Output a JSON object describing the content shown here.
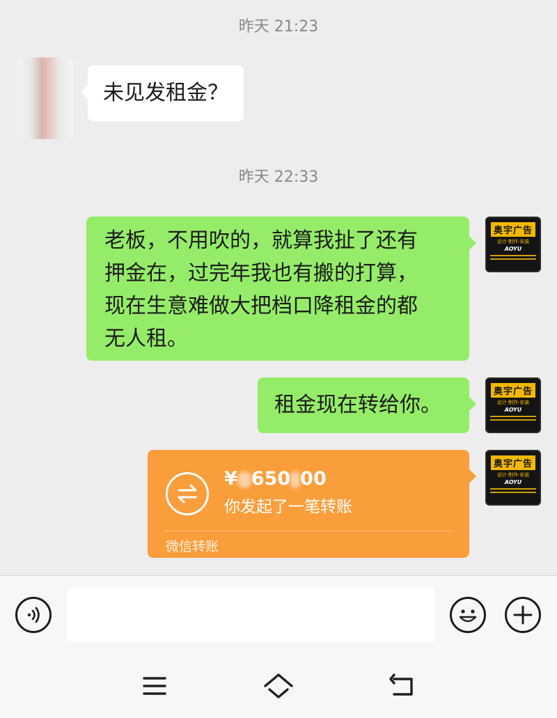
{
  "timestamps": [
    "昨天 21:23",
    "昨天 22:33"
  ],
  "brand_avatar": {
    "title": "奥宇广告",
    "subtitle": "设计·制作·安装",
    "pinyin": "AOYU"
  },
  "messages": [
    {
      "side": "left",
      "text": "未见发租金？"
    },
    {
      "side": "right",
      "lines": [
        "老板，不用吹的，就算我扯了还有",
        "押金在，过完年我也有搬的打算，",
        "现在生意难做大把档口降租金的都",
        "无人租。"
      ]
    },
    {
      "side": "right",
      "text": "租金现在转给你。"
    }
  ],
  "transfer": {
    "amount_prefix": "¥",
    "amount_visible_mid": "650",
    "amount_visible_end": "00",
    "description": "你发起了一笔转账",
    "footer": "微信转账"
  },
  "input": {
    "value": "",
    "placeholder": ""
  },
  "icons": {
    "voice": "voice-icon",
    "emoji": "emoji-icon",
    "add": "plus-icon",
    "transfer": "transfer-arrows-icon",
    "nav_menu": "menu-icon",
    "nav_home": "home-icon",
    "nav_back": "back-icon"
  },
  "colors": {
    "chat_background": "#ededed",
    "bubble_green": "#95ec69",
    "bubble_white": "#ffffff",
    "transfer_orange": "#fa9d3b",
    "timestamp_gray": "#888888",
    "brand_yellow": "#f2b800"
  }
}
